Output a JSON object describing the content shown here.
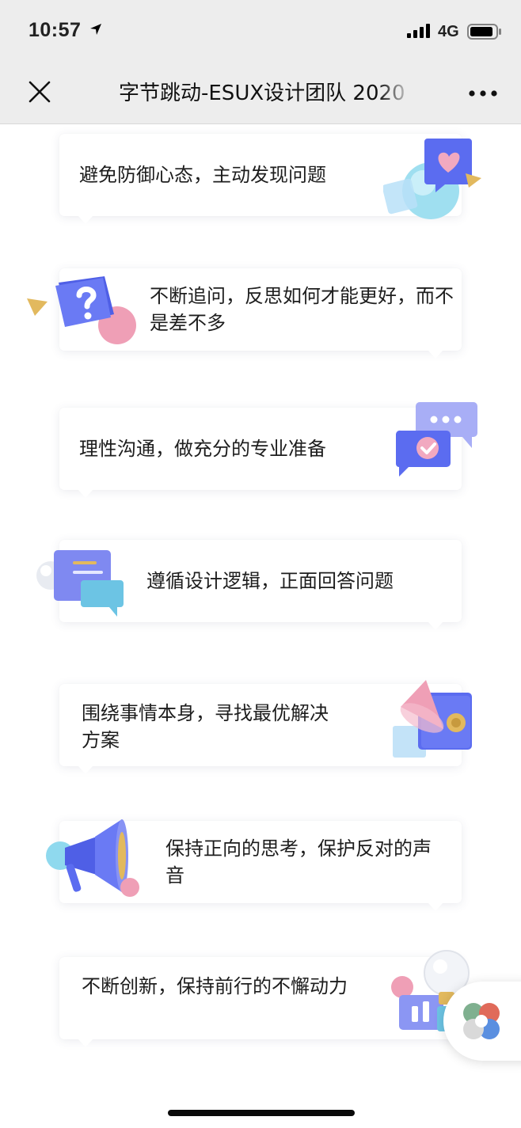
{
  "status_bar": {
    "time": "10:57",
    "network": "4G"
  },
  "nav": {
    "title": "字节跳动-ESUX设计团队 2020"
  },
  "cards": [
    {
      "text": "避免防御心态，主动发现问题"
    },
    {
      "text": "不断追问，反思如何才能更好，而不是差不多"
    },
    {
      "text": "理性沟通，做充分的专业准备"
    },
    {
      "text": "遵循设计逻辑，正面回答问题"
    },
    {
      "text": "围绕事情本身，寻找最优解决方案"
    },
    {
      "text": "保持正向的思考，保护反对的声音"
    },
    {
      "text": "不断创新，保持前行的不懈动力"
    }
  ],
  "icons": [
    "location-arrow-icon",
    "signal-icon",
    "battery-icon",
    "close-icon",
    "more-icon",
    "heart-bubble-icon",
    "question-box-icon",
    "chat-bubble-check-icon",
    "document-chat-icon",
    "cone-cube-icon",
    "megaphone-icon",
    "lightbulb-chart-icon",
    "floating-app-icon"
  ],
  "colors": {
    "accent": "#5b6cf0",
    "pink": "#ec98b0",
    "cyan": "#8fd9ee",
    "gold": "#e2b95e"
  }
}
